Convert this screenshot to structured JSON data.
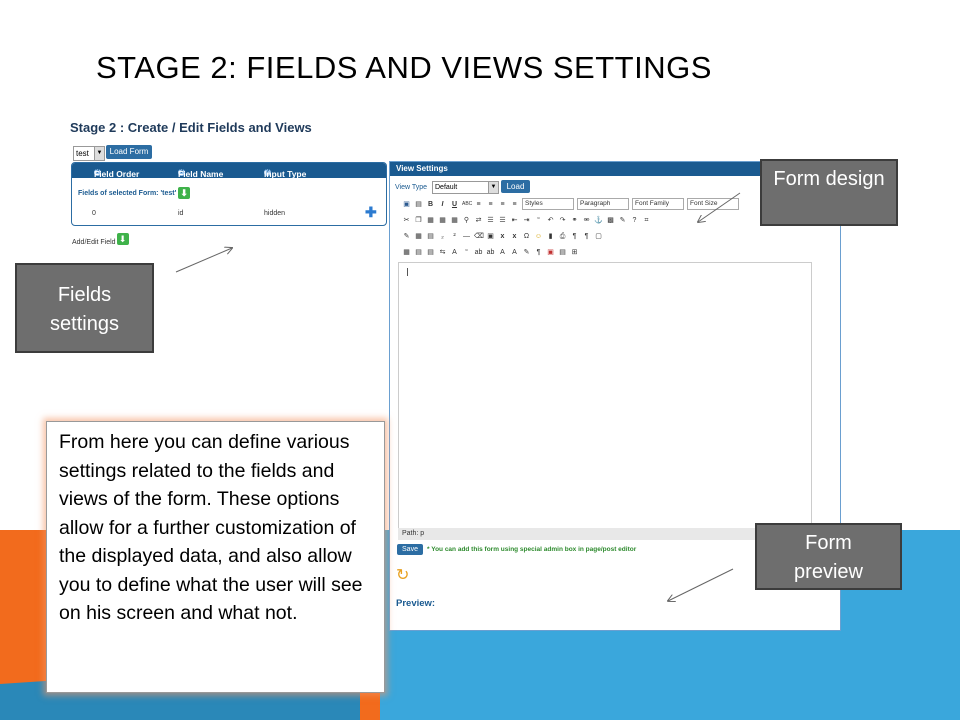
{
  "slide": {
    "title": "STAGE 2: FIELDS AND VIEWS SETTINGS"
  },
  "screenshot": {
    "title": "Stage 2 : Create / Edit Fields and Views",
    "form_select": "test",
    "load_form_button": "Load Form",
    "fields_table": {
      "headers": [
        "Field Order",
        "Field Name",
        "Input Type"
      ],
      "subheading": "Fields of selected Form: 'test'",
      "row": {
        "order": "0",
        "name": "id",
        "type": "hidden"
      }
    },
    "add_edit_field": "Add/Edit Field",
    "view_settings": {
      "header": "View Settings",
      "view_type_label": "View Type",
      "view_type_value": "Default",
      "load_button": "Load",
      "styles_dropdown": "Styles",
      "paragraph_dropdown": "Paragraph",
      "font_family_dropdown": "Font Family",
      "font_size_dropdown": "Font Size",
      "path": "Path: p",
      "save_button": "Save",
      "save_note": "* You can add this form using special admin box in page/post editor",
      "preview_label": "Preview:"
    }
  },
  "callouts": {
    "form_design": "Form design",
    "fields_settings": "Fields settings",
    "form_preview": "Form preview",
    "description": "From here you can define various settings related to the fields and views of the form. These options allow for a further customization of the displayed data, and also allow you to define what the user will see on his screen and what not."
  },
  "colors": {
    "orange": "#f26b1d",
    "blue": "#3aa7dc",
    "panel_header": "#1a5a90",
    "callout_grey": "#6e6e6e"
  }
}
